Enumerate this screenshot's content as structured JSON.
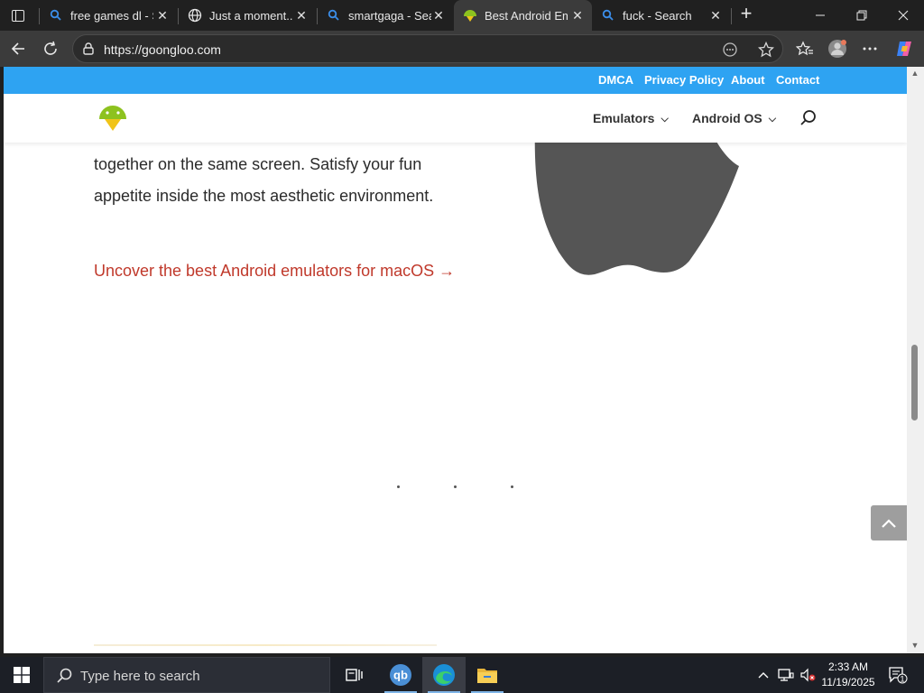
{
  "browser": {
    "tabs": [
      {
        "title": "free games dl - S",
        "favicon": "search-icon",
        "active": false
      },
      {
        "title": "Just a moment...",
        "favicon": "globe-icon",
        "active": false
      },
      {
        "title": "smartgaga - Sear",
        "favicon": "search-icon",
        "active": false
      },
      {
        "title": "Best Android Em",
        "favicon": "android-icon",
        "active": true
      },
      {
        "title": "fuck - Search",
        "favicon": "search-icon",
        "active": false
      }
    ],
    "close_glyph": "✕",
    "new_tab_glyph": "+",
    "address": {
      "url": "https://goongloo.com"
    },
    "window_controls": {
      "minimize": "—",
      "restore": "❐",
      "close": "✕"
    }
  },
  "page": {
    "top_links": [
      "DMCA",
      "Privacy Policy",
      "About",
      "Contact"
    ],
    "nav": {
      "items": [
        {
          "label": "Emulators"
        },
        {
          "label": "Android OS"
        }
      ]
    },
    "body": {
      "line1": "together on the same screen. Satisfy your fun",
      "line2": "appetite inside the most aesthetic environment.",
      "cta": "Uncover the best Android emulators for macOS →"
    },
    "colors": {
      "topbar": "#2ea3f2",
      "link": "#c0392b",
      "apple": "#555555",
      "android_green": "#8dc21f"
    }
  },
  "taskbar": {
    "search_placeholder": "Type here to search",
    "apps": [
      "task-view-icon",
      "qbittorrent-icon",
      "edge-icon",
      "file-explorer-icon"
    ],
    "qb_label": "qb",
    "clock": {
      "time": "2:33 AM",
      "date": "11/19/2025"
    },
    "notification_count": "1"
  }
}
